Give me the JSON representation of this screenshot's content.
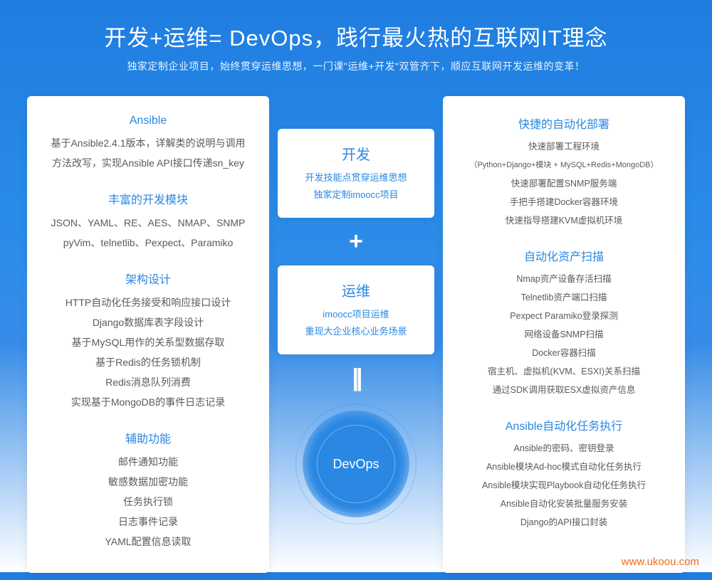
{
  "hero": {
    "title": "开发+运维= DevOps，践行最火热的互联网IT理念",
    "subtitle": "独家定制企业项目，始终贯穿运维思想，一门课\"运维+开发\"双管齐下，顺应互联网开发运维的变革！"
  },
  "left": {
    "s1": {
      "title": "Ansible",
      "items": [
        "基于Ansible2.4.1版本，详解类的说明与调用",
        "方法改写，实现Ansible API接口传递sn_key"
      ]
    },
    "s2": {
      "title": "丰富的开发模块",
      "items": [
        "JSON、YAML、RE、AES、NMAP、SNMP",
        "pyVim、telnetlib、Pexpect、Paramiko"
      ]
    },
    "s3": {
      "title": "架构设计",
      "items": [
        "HTTP自动化任务接受和响应接口设计",
        "Django数据库表字段设计",
        "基于MySQL用作的关系型数据存取",
        "基于Redis的任务锁机制",
        "Redis消息队列消费",
        "实现基于MongoDB的事件日志记录"
      ]
    },
    "s4": {
      "title": "辅助功能",
      "items": [
        "邮件通知功能",
        "敏感数据加密功能",
        "任务执行锁",
        "日志事件记录",
        "YAML配置信息读取"
      ]
    }
  },
  "center": {
    "c1": {
      "big": "开发",
      "sub1": "开发技能点贯穿运维思想",
      "sub2": "独家定制imoocc项目"
    },
    "plus": "+",
    "c2": {
      "big": "运维",
      "sub1": "imoocc项目运维",
      "sub2": "重现大企业核心业务场景"
    },
    "equals": "||",
    "devops": "DevOps"
  },
  "right": {
    "s1": {
      "title": "快捷的自动化部署",
      "items": [
        "快速部署工程环境",
        "（Python+Django+模块 + MySQL+Redis+MongoDB）",
        "快速部署配置SNMP服务端",
        "手把手搭建Docker容器环境",
        "快速指导搭建KVM虚拟机环境"
      ]
    },
    "s2": {
      "title": "自动化资产扫描",
      "items": [
        "Nmap资产设备存活扫描",
        "Telnetlib资产端口扫描",
        "Pexpect Paramiko登录探测",
        "网络设备SNMP扫描",
        "Docker容器扫描",
        "宿主机、虚拟机(KVM、ESXI)关系扫描",
        "通过SDK调用获取ESX虚拟资产信息"
      ]
    },
    "s3": {
      "title": "Ansible自动化任务执行",
      "items": [
        "Ansible的密码、密钥登录",
        "Ansible模块Ad-hoc模式自动化任务执行",
        "Ansible模块实现Playbook自动化任务执行",
        "Ansible自动化安装批量服务安装",
        "Django的API接口封装"
      ]
    }
  },
  "watermark": "www.ukoou.com"
}
